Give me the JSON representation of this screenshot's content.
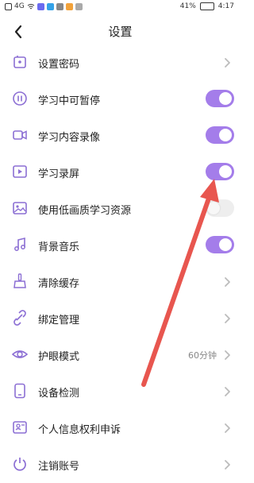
{
  "status_bar": {
    "signal_text": "4G",
    "battery_percent": "41%",
    "time": "4:17"
  },
  "header": {
    "title": "设置"
  },
  "items": [
    {
      "key": "password",
      "label": "设置密码",
      "icon": "lock-icon",
      "control": "chevron"
    },
    {
      "key": "pause",
      "label": "学习中可暂停",
      "icon": "pause-icon",
      "control": "toggle",
      "on": true
    },
    {
      "key": "record-video",
      "label": "学习内容录像",
      "icon": "video-camera-icon",
      "control": "toggle",
      "on": true
    },
    {
      "key": "screen-record",
      "label": "学习录屏",
      "icon": "play-screen-icon",
      "control": "toggle",
      "on": true
    },
    {
      "key": "low-quality",
      "label": "使用低画质学习资源",
      "icon": "image-icon",
      "control": "toggle",
      "on": false
    },
    {
      "key": "music",
      "label": "背景音乐",
      "icon": "music-note-icon",
      "control": "toggle",
      "on": true
    },
    {
      "key": "cache",
      "label": "清除缓存",
      "icon": "broom-icon",
      "control": "chevron"
    },
    {
      "key": "binding",
      "label": "绑定管理",
      "icon": "link-icon",
      "control": "chevron"
    },
    {
      "key": "eye",
      "label": "护眼模式",
      "icon": "eye-icon",
      "control": "chevron",
      "value": "60分钟"
    },
    {
      "key": "device",
      "label": "设备检测",
      "icon": "phone-icon",
      "control": "chevron"
    },
    {
      "key": "privacy",
      "label": "个人信息权利申诉",
      "icon": "id-card-icon",
      "control": "chevron"
    },
    {
      "key": "logout",
      "label": "注销账号",
      "icon": "power-icon",
      "control": "chevron"
    }
  ],
  "colors": {
    "accent": "#a47dea",
    "icon": "#8c6fd4",
    "toggle_off": "#eeeeee",
    "chevron": "#bbbbbb",
    "annotation_arrow": "#e8564f"
  }
}
